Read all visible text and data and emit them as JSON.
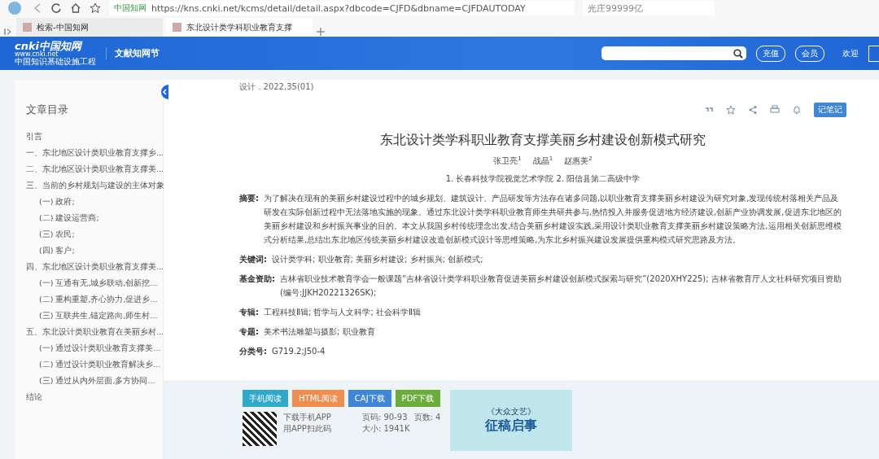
{
  "browser": {
    "site_badge": "中国知网",
    "url": "https://kns.cnki.net/kcms/detail/detail.aspx?dbcode=CJFD&dbname=CJFDAUTODAY",
    "search_text": "光庄99999亿",
    "tabs": [
      {
        "title": "检索-中国知网",
        "selected": false
      },
      {
        "title": "东北设计类学科职业教育支撑",
        "selected": true
      }
    ]
  },
  "header": {
    "logo_main": "cnki中国知网",
    "logo_url": "www.cnki.net",
    "logo_sub": "中国知识基础设施工程",
    "section": "文献知网节",
    "buttons": [
      "充值",
      "会员"
    ],
    "welcome": "欢迎"
  },
  "sidebar": {
    "title": "文章目录",
    "items": [
      {
        "label": "引言"
      },
      {
        "label": "一、东北地区设计类职业教育支撑乡..."
      },
      {
        "label": "二、东北地区设计类职业教育支撑美..."
      },
      {
        "label": "三、当前的乡村规划与建设的主体对象",
        "children": [
          {
            "label": "(一) 政府;"
          },
          {
            "label": "(二) 建设运营商;"
          },
          {
            "label": "(三) 农民;"
          },
          {
            "label": "(四) 客户;"
          }
        ]
      },
      {
        "label": "四、东北地区设计类职业教育支撑美...",
        "children": [
          {
            "label": "(一) 互通有无,城乡联动,创新挖..."
          },
          {
            "label": "(二) 重构重塑,齐心协力,促进乡..."
          },
          {
            "label": "(三) 互联共生,锚定路向,师生村..."
          }
        ]
      },
      {
        "label": "五、东北设计类职业教育在美丽乡村...",
        "children": [
          {
            "label": "(一) 通过设计类职业教育支撑美..."
          },
          {
            "label": "(二) 通过设计类职业教育解决乡..."
          },
          {
            "label": "(三) 通过从内外层面,多方协同..."
          }
        ]
      },
      {
        "label": "结论"
      }
    ]
  },
  "article": {
    "source": "设计 . 2022,35(01)",
    "note_button": "记笔记",
    "title": "东北设计类学科职业教育支撑美丽乡村建设创新模式研究",
    "authors": [
      "张卫亮$^{1}$",
      "战晶$^{1}$",
      "赵惠美$^{2}$"
    ],
    "affiliations": "1. 长春科技学院视觉艺术学院  2. 阳信县第二高级中学",
    "fields": [
      {
        "label": "摘要:",
        "value": "为了解决在现有的美丽乡村建设过程中的城乡规划、建筑设计、产品研发等方法存在诸多问题,以职业教育支撑美丽乡村建设为研究对象,发现传统村落相关产品及研发在实际创新过程中无法落地实施的现象。通过东北设计类学科职业教育师生共研共参与,热情投入并服务促进地方经济建设,创新产业协调发展,促进东北地区的美丽乡村建设和乡村振兴事业的目的。本文从我国乡村传统理念出发,结合美丽乡村建设实践,采用设计类职业教育支撑美丽乡村建设策略方法,运用相关创新思维模式分析结果,总结出东北地区传统美丽乡村建设改造创新模式设计等思维策略,为东北乡村振兴建设发展提供重构模式研究思路及方法。"
      },
      {
        "label": "关键词:",
        "value": "设计类学科;  职业教育;  美丽乡村建设;  乡村振兴;  创新模式;"
      },
      {
        "label": "基金资助:",
        "value": "吉林省职业技术教育学会一般课题“吉林省设计类学科职业教育促进美丽乡村建设创新模式探索与研究”(2020XHY225);  吉林省教育厅人文社科研究项目资助(编号:JJKH20221326SK);"
      },
      {
        "label": "专辑:",
        "value": "工程科技Ⅱ辑; 哲学与人文科学; 社会科学Ⅱ辑"
      },
      {
        "label": "专题:",
        "value": "美术书法雕塑与摄影; 职业教育"
      },
      {
        "label": "分类号:",
        "value": "G719.2;J50-4"
      }
    ],
    "actions": [
      {
        "label": "手机阅读",
        "color": "#2fa8cc"
      },
      {
        "label": "HTML阅读",
        "color": "#f08c4c"
      },
      {
        "label": "CAJ下载",
        "color": "#3f86d6"
      },
      {
        "label": "PDF下载",
        "color": "#6aad3a"
      }
    ],
    "app_download": "下载手机APP",
    "app_hint": "用APP扫此码",
    "pages": "页码: 90-93",
    "page_count": "页数: 4",
    "size": "大小: 1941K",
    "ad_magazine": "《大众文艺》",
    "ad_title": "征稿启事"
  }
}
